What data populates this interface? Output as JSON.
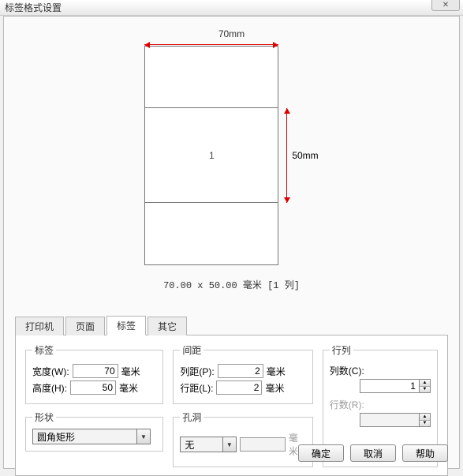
{
  "window": {
    "title": "标签格式设置",
    "close_glyph": "✕"
  },
  "preview": {
    "width_label": "70mm",
    "height_label": "50mm",
    "cell_number": "1",
    "caption": "70.00 x 50.00 毫米 [1 列]"
  },
  "tabs": {
    "printer": "打印机",
    "page": "页面",
    "label": "标签",
    "other": "其它"
  },
  "groups": {
    "label": "标签",
    "gap": "间距",
    "rowcol": "行列",
    "shape": "形状",
    "hole": "孔洞"
  },
  "form": {
    "width_label": "宽度(W):",
    "width_value": "70",
    "height_label": "高度(H):",
    "height_value": "50",
    "unit_mm": "毫米",
    "colgap_label": "列距(P):",
    "colgap_value": "2",
    "rowgap_label": "行距(L):",
    "rowgap_value": "2",
    "cols_label": "列数(C):",
    "cols_value": "1",
    "rows_label": "行数(R):",
    "rows_value": "",
    "shape_options": [
      "圆角矩形"
    ],
    "shape_selected": "圆角矩形",
    "hole_options": [
      "无"
    ],
    "hole_selected": "无",
    "hole_dim": ""
  },
  "buttons": {
    "ok": "确定",
    "cancel": "取消",
    "help": "帮助"
  }
}
